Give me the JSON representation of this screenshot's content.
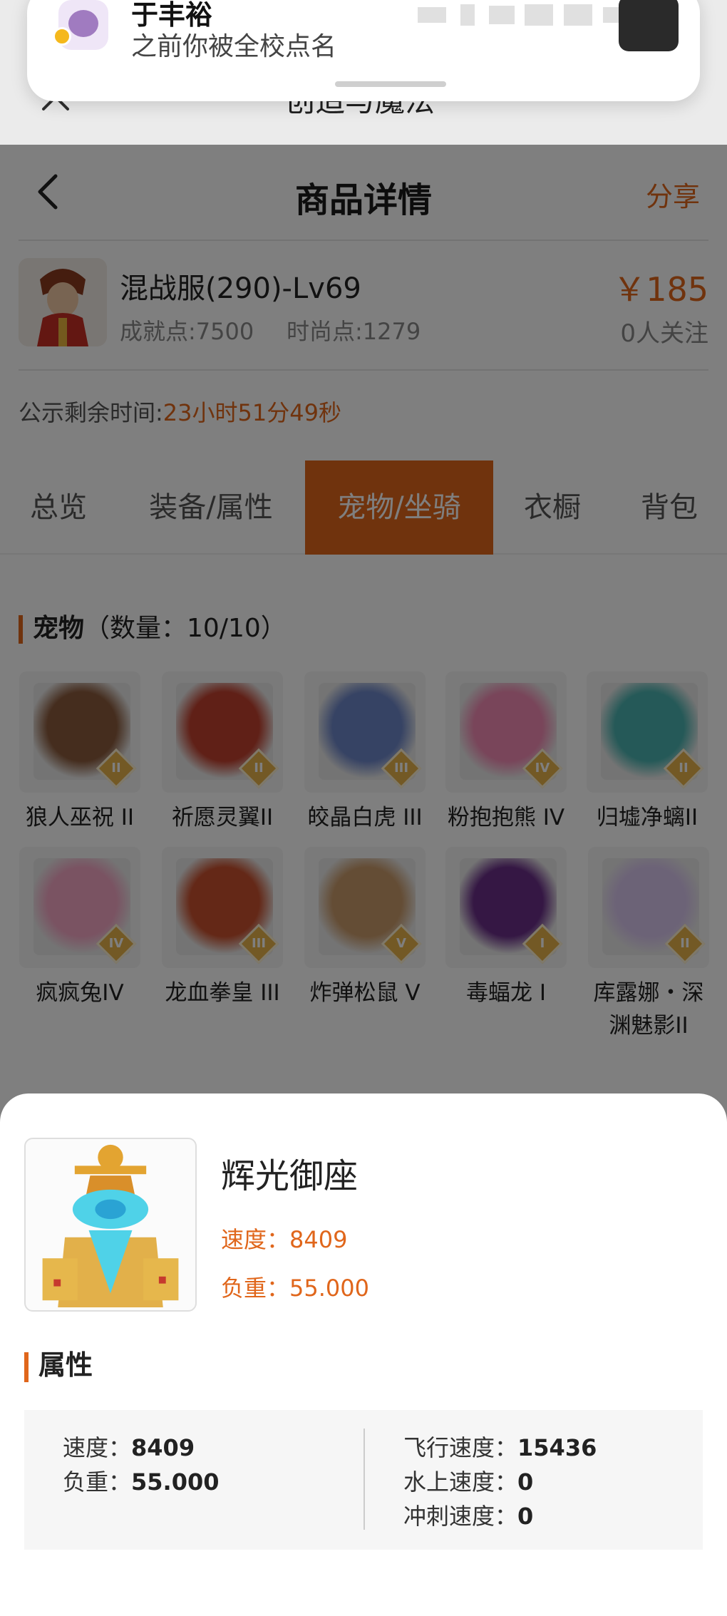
{
  "notification": {
    "sender": "于丰裕",
    "message": "之前你被全校点名"
  },
  "mini_header": {
    "title": "创造与魔法"
  },
  "navbar": {
    "title": "商品详情",
    "share": "分享"
  },
  "goods": {
    "name": "混战服(290)-Lv69",
    "achievement": "成就点:7500",
    "fashion": "时尚点:1279",
    "price": "￥185",
    "followers": "0人关注"
  },
  "countdown": {
    "label": "公示剩余时间:",
    "time": "23小时51分49秒"
  },
  "tabs": [
    {
      "label": "总览"
    },
    {
      "label": "装备/属性"
    },
    {
      "label": "宠物/坐骑"
    },
    {
      "label": "衣橱"
    },
    {
      "label": "背包"
    }
  ],
  "pets_section": {
    "title": "宠物",
    "count": "（数量：10/10）"
  },
  "pets": [
    {
      "name": "狼人巫祝 II",
      "tier": "II",
      "color": "#8a5a3c"
    },
    {
      "name": "祈愿灵翼II",
      "tier": "II",
      "color": "#c0402e"
    },
    {
      "name": "皎晶白虎 III",
      "tier": "III",
      "color": "#6d86c8"
    },
    {
      "name": "粉抱抱熊 IV",
      "tier": "IV",
      "color": "#f28bb4"
    },
    {
      "name": "归墟净螭II",
      "tier": "II",
      "color": "#4bb3b0"
    },
    {
      "name": "疯疯兔IV",
      "tier": "IV",
      "color": "#f4a7c5"
    },
    {
      "name": "龙血拳皇 III",
      "tier": "III",
      "color": "#c8502e"
    },
    {
      "name": "炸弹松鼠 V",
      "tier": "V",
      "color": "#c99a6a"
    },
    {
      "name": "毒蝠龙 I",
      "tier": "I",
      "color": "#6a2f88"
    },
    {
      "name": "库露娜・深渊魅影II",
      "tier": "II",
      "color": "#d9c6ef"
    }
  ],
  "sheet": {
    "mount_name": "辉光御座",
    "speed_line": "速度：8409",
    "load_line": "负重：55.000",
    "attr_title": "属性",
    "attrs_left": [
      {
        "label": "速度：",
        "value": "8409"
      },
      {
        "label": "负重：",
        "value": "55.000"
      }
    ],
    "attrs_right": [
      {
        "label": "飞行速度：",
        "value": "15436"
      },
      {
        "label": "水上速度：",
        "value": "0"
      },
      {
        "label": "冲刺速度：",
        "value": "0"
      }
    ]
  },
  "colors": {
    "accent": "#e0661b",
    "overlay": "rgba(0,0,0,0.5)"
  }
}
